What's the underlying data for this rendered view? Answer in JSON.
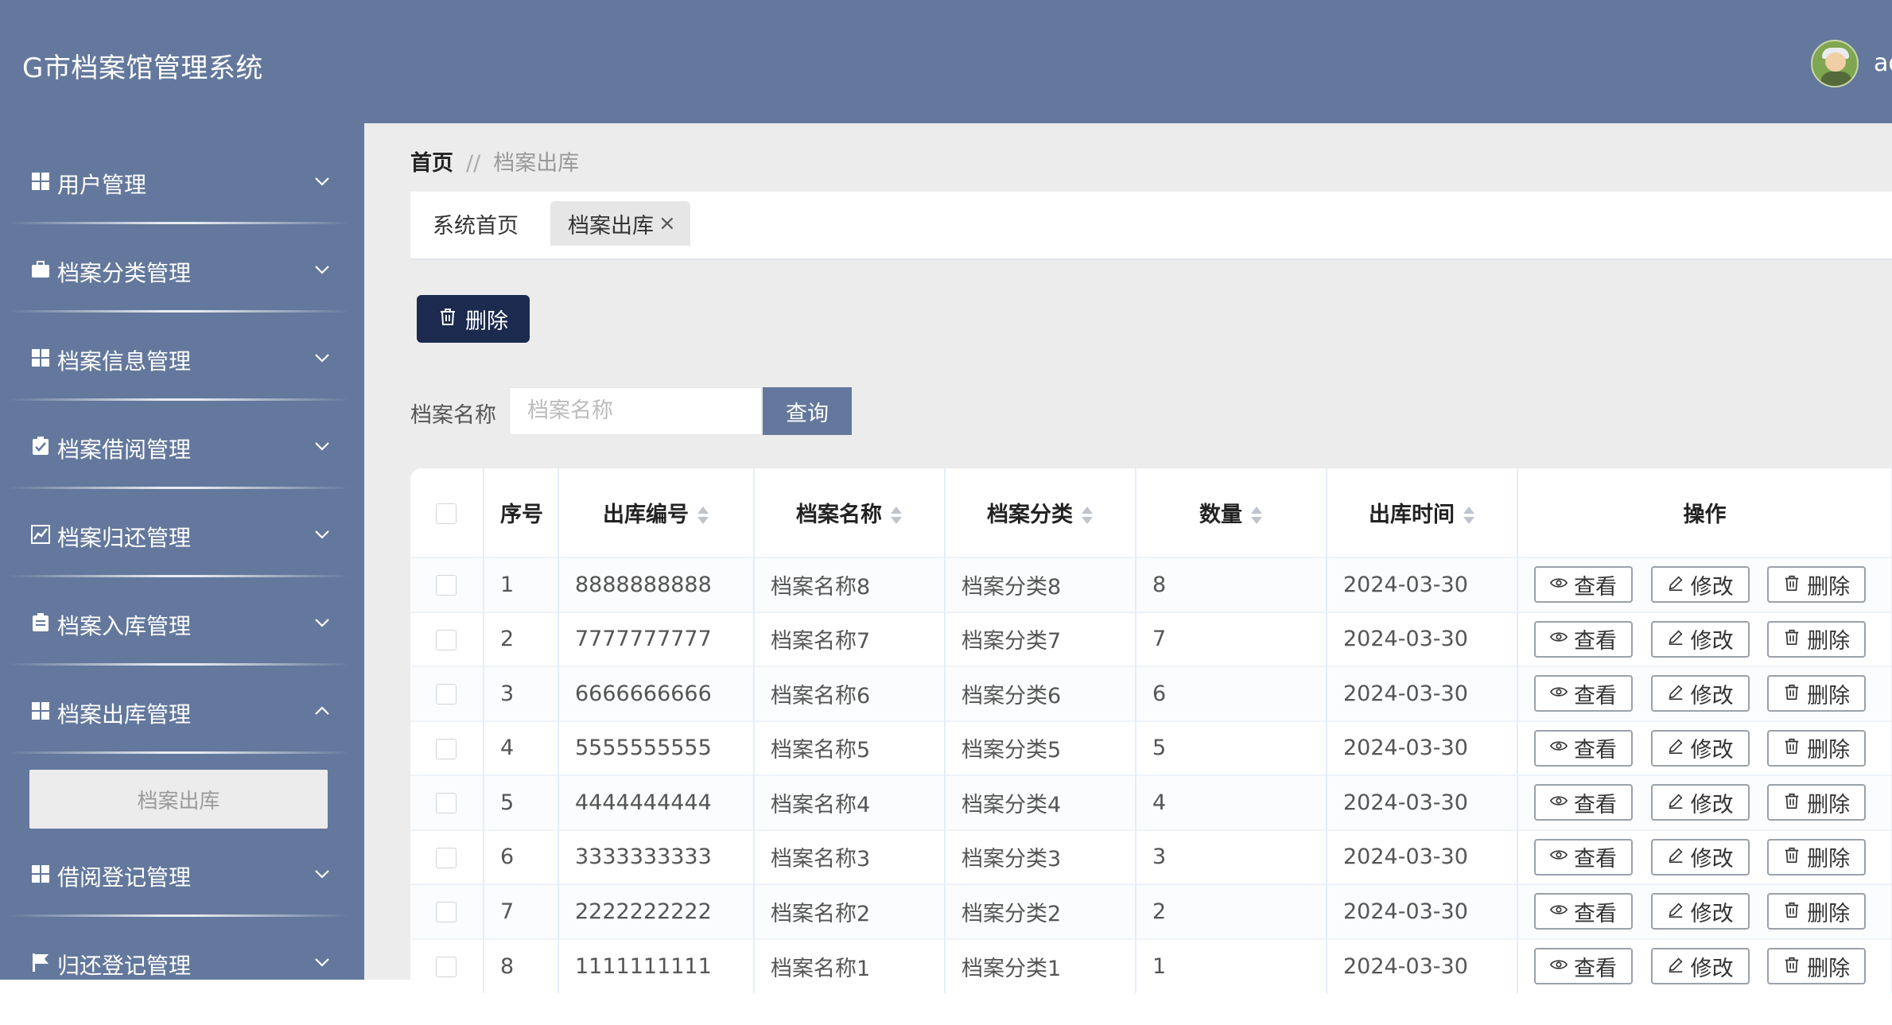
{
  "app": {
    "title": "G市档案馆管理系统",
    "user": "ad"
  },
  "sidebar": {
    "items": [
      {
        "label": "用户管理",
        "icon": "grid-icon",
        "expanded": false
      },
      {
        "label": "档案分类管理",
        "icon": "briefcase-icon",
        "expanded": false
      },
      {
        "label": "档案信息管理",
        "icon": "grid-icon",
        "expanded": false
      },
      {
        "label": "档案借阅管理",
        "icon": "clipboard-check-icon",
        "expanded": false
      },
      {
        "label": "档案归还管理",
        "icon": "line-chart-icon",
        "expanded": false
      },
      {
        "label": "档案入库管理",
        "icon": "clipboard-icon",
        "expanded": false
      },
      {
        "label": "档案出库管理",
        "icon": "grid-icon",
        "expanded": true
      },
      {
        "label": "借阅登记管理",
        "icon": "grid-icon",
        "expanded": false
      },
      {
        "label": "归还登记管理",
        "icon": "flag-icon",
        "expanded": false
      }
    ],
    "submenu": {
      "label": "档案出库"
    }
  },
  "breadcrumb": {
    "home": "首页",
    "separator": "//",
    "current": "档案出库"
  },
  "tabs": [
    {
      "label": "系统首页",
      "active": false
    },
    {
      "label": "档案出库",
      "active": true,
      "close": "×"
    }
  ],
  "toolbar": {
    "delete_label": "删除"
  },
  "search": {
    "label": "档案名称",
    "placeholder": "档案名称",
    "button": "查询"
  },
  "table": {
    "headers": [
      "序号",
      "出库编号",
      "档案名称",
      "档案分类",
      "数量",
      "出库时间",
      "操作"
    ],
    "rows": [
      [
        "1",
        "8888888888",
        "档案名称8",
        "档案分类8",
        "8",
        "2024-03-30"
      ],
      [
        "2",
        "7777777777",
        "档案名称7",
        "档案分类7",
        "7",
        "2024-03-30"
      ],
      [
        "3",
        "6666666666",
        "档案名称6",
        "档案分类6",
        "6",
        "2024-03-30"
      ],
      [
        "4",
        "5555555555",
        "档案名称5",
        "档案分类5",
        "5",
        "2024-03-30"
      ],
      [
        "5",
        "4444444444",
        "档案名称4",
        "档案分类4",
        "4",
        "2024-03-30"
      ],
      [
        "6",
        "3333333333",
        "档案名称3",
        "档案分类3",
        "3",
        "2024-03-30"
      ],
      [
        "7",
        "2222222222",
        "档案名称2",
        "档案分类2",
        "2",
        "2024-03-30"
      ],
      [
        "8",
        "1111111111",
        "档案名称1",
        "档案分类1",
        "1",
        "2024-03-30"
      ]
    ],
    "actions": {
      "view": "查看",
      "edit": "修改",
      "delete": "删除"
    }
  },
  "colors": {
    "header_bg": "#63789c",
    "sidebar_bg": "#63789c",
    "primary_button": "#1b2a4e",
    "query_button": "#63789c"
  }
}
